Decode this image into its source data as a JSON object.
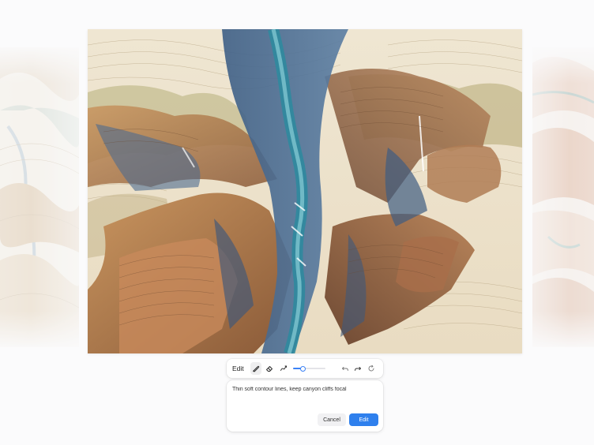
{
  "toolbar": {
    "mode_label": "Edit",
    "tools": [
      {
        "icon": "brush-icon",
        "active": true
      },
      {
        "icon": "eraser-icon",
        "active": false
      },
      {
        "icon": "lasso-icon",
        "active": false
      }
    ],
    "brush_size_fraction": 0.3,
    "accent_color": "#3b82f6"
  },
  "prompt": {
    "text": "Thin soft contour lines, keep canyon cliffs focal",
    "cancel_label": "Cancel",
    "submit_label": "Edit"
  },
  "image": {
    "subject": "canyon-illustration"
  }
}
